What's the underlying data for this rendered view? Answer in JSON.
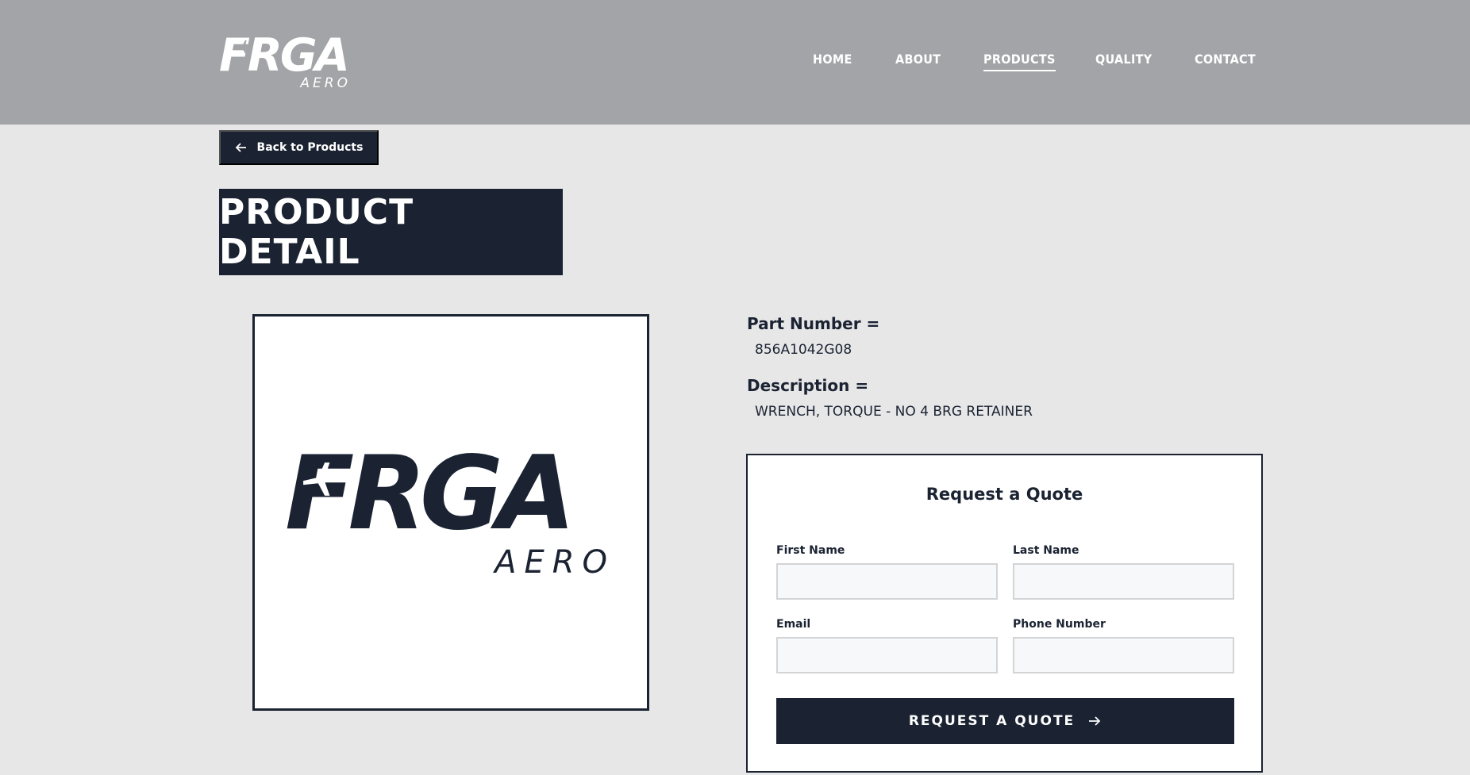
{
  "brand": {
    "logo_text": "FRGA",
    "logo_sub": "AERO",
    "colors": {
      "navy": "#1b2332",
      "header_gray": "#a3a4a7",
      "page_bg": "#e7e7e8"
    }
  },
  "nav": {
    "items": [
      {
        "label": "HOME",
        "active": false
      },
      {
        "label": "ABOUT",
        "active": false
      },
      {
        "label": "PRODUCTS",
        "active": true
      },
      {
        "label": "QUALITY",
        "active": false
      },
      {
        "label": "CONTACT",
        "active": false
      }
    ]
  },
  "back_button": {
    "label": "Back to Products",
    "icon": "arrow-left-icon"
  },
  "page_title": "PRODUCT DETAIL",
  "product": {
    "part_number_label": "Part Number =",
    "part_number": "856A1042G08",
    "description_label": "Description =",
    "description": "WRENCH, TORQUE - NO 4 BRG RETAINER"
  },
  "quote_form": {
    "title": "Request a Quote",
    "first_name_label": "First Name",
    "last_name_label": "Last Name",
    "email_label": "Email",
    "phone_label": "Phone Number",
    "first_name_value": "",
    "last_name_value": "",
    "email_value": "",
    "phone_value": "",
    "submit_label": "REQUEST A QUOTE",
    "submit_icon": "arrow-right-icon"
  }
}
